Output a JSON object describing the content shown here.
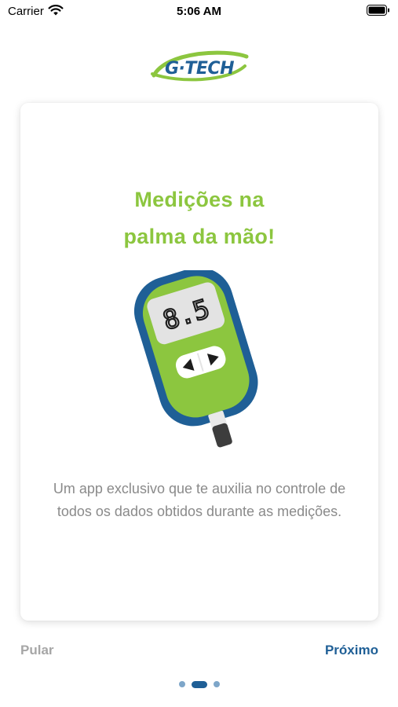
{
  "status_bar": {
    "carrier": "Carrier",
    "time": "5:06 AM"
  },
  "brand": {
    "logo_text": "G·TECH",
    "green": "#8cc63f",
    "blue": "#1f5f96"
  },
  "onboarding": {
    "title": "Medições na\npalma da mão!",
    "meter_display": "8.5",
    "description": "Um app exclusivo que te auxilia no controle de todos os dados obtidos durante as medições."
  },
  "navigation": {
    "skip_label": "Pular",
    "next_label": "Próximo"
  },
  "pager": {
    "total_pages": 3,
    "current_page": 2
  }
}
